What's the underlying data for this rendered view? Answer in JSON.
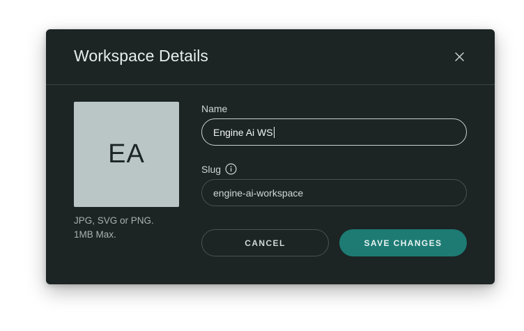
{
  "dialog": {
    "title": "Workspace Details",
    "close_icon": "close-icon"
  },
  "avatar": {
    "initials": "EA",
    "hint_line1": "JPG, SVG or PNG.",
    "hint_line2": "1MB Max."
  },
  "form": {
    "name": {
      "label": "Name",
      "value": "Engine Ai WS"
    },
    "slug": {
      "label": "Slug",
      "info_icon": "info-icon",
      "value": "engine-ai-workspace"
    }
  },
  "actions": {
    "cancel_label": "CANCEL",
    "save_label": "SAVE CHANGES"
  },
  "colors": {
    "dialog_bg": "#1c2424",
    "avatar_bg": "#b9c6c5",
    "primary": "#1d7b74"
  }
}
